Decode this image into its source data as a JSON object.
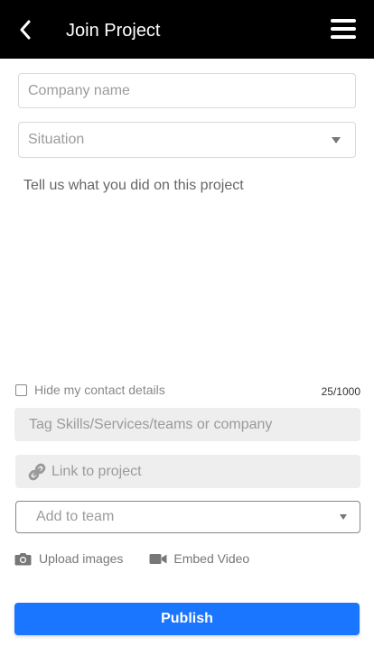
{
  "header": {
    "title": "Join Project",
    "back_icon": "chevron-left-icon",
    "menu_icon": "hamburger-menu-icon",
    "background": "#000000"
  },
  "form": {
    "company_placeholder": "Company name",
    "situation_placeholder": "Situation",
    "description_placeholder": "Tell us what you did on this project",
    "hide_contact_label": "Hide my contact details",
    "hide_contact_checked": false,
    "char_counter": "25/1000",
    "tag_placeholder": "Tag Skills/Services/teams or company",
    "link_placeholder": "Link to project",
    "team_placeholder": "Add to team",
    "upload_label": "Upload images",
    "embed_label": "Embed Video"
  },
  "actions": {
    "publish_label": "Publish",
    "accent": "#1a75ff"
  }
}
